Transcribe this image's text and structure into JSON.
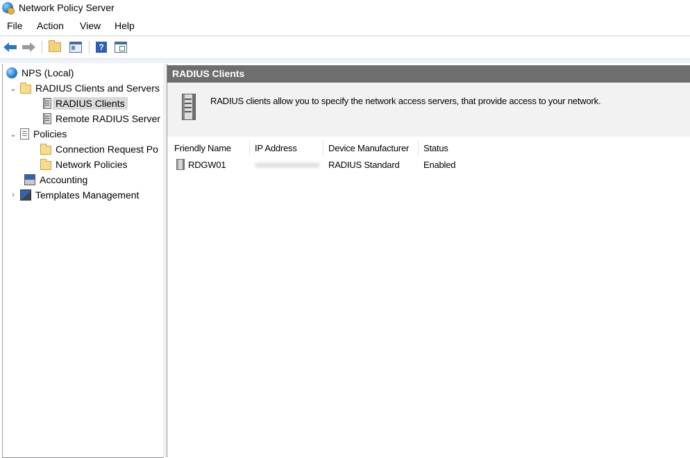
{
  "window": {
    "title": "Network Policy Server",
    "icon": "nps-globe-icon"
  },
  "menubar": {
    "items": [
      "File",
      "Action",
      "View",
      "Help"
    ]
  },
  "toolbar": {
    "buttons": [
      "back-arrow-icon",
      "forward-arrow-icon",
      "up-folder-icon",
      "show-hide-tree-icon",
      "help-icon",
      "properties-icon"
    ]
  },
  "tree": {
    "items": [
      {
        "label": "NPS (Local)",
        "icon": "globe-icon",
        "expander": "",
        "depth": 0
      },
      {
        "label": "RADIUS Clients and Servers",
        "icon": "folder-icon",
        "expander": "expanded",
        "depth": 1
      },
      {
        "label": "RADIUS Clients",
        "icon": "server-icon",
        "expander": "",
        "depth": 2,
        "selected": true
      },
      {
        "label": "Remote RADIUS Server",
        "icon": "server-group-icon",
        "expander": "",
        "depth": 2
      },
      {
        "label": "Policies",
        "icon": "document-icon",
        "expander": "expanded",
        "depth": 1
      },
      {
        "label": "Connection Request Po",
        "icon": "folder-icon",
        "expander": "",
        "depth": 2
      },
      {
        "label": "Network Policies",
        "icon": "folder-icon",
        "expander": "",
        "depth": 2
      },
      {
        "label": "Accounting",
        "icon": "accounting-icon",
        "expander": "",
        "depth": 1
      },
      {
        "label": "Templates Management",
        "icon": "templates-icon",
        "expander": "collapsed",
        "depth": 1
      }
    ]
  },
  "content": {
    "header": "RADIUS Clients",
    "description": "RADIUS clients allow you to specify the network access servers, that provide access to your network.",
    "columns": [
      "Friendly Name",
      "IP Address",
      "Device Manufacturer",
      "Status"
    ],
    "rows": [
      {
        "friendly_name": "RDGW01",
        "ip_address": "",
        "manufacturer": "RADIUS Standard",
        "status": "Enabled"
      }
    ]
  },
  "colors": {
    "header_bg": "#6e6e6e",
    "selected_bg": "#d9d9d9",
    "description_bg": "#f2f2f2"
  }
}
